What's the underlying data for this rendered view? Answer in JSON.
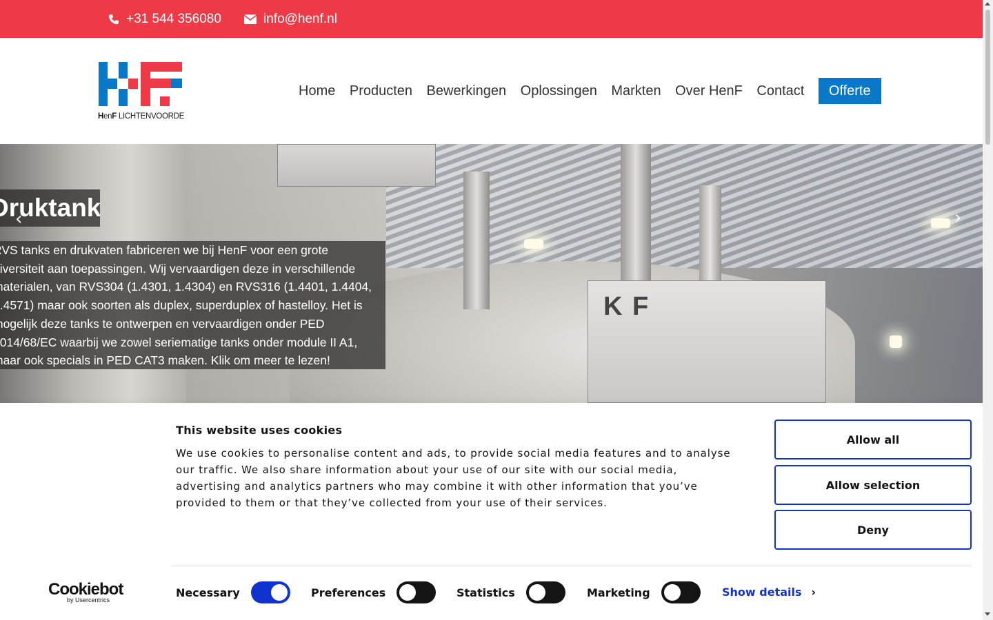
{
  "topbar": {
    "phone": "+31 544 356080",
    "email": "info@henf.nl",
    "bg_color": "#ee3a46"
  },
  "logo": {
    "text_bold1": "H",
    "text_en": "en",
    "text_bold2": "F",
    "text_rest": " LICHTENVOORDE"
  },
  "nav": {
    "items": [
      "Home",
      "Producten",
      "Bewerkingen",
      "Oplossingen",
      "Markten",
      "Over HenF",
      "Contact"
    ],
    "cta": "Offerte",
    "cta_color": "#0a78c8"
  },
  "hero": {
    "title": "Druktanks",
    "text": "RVS tanks en drukvaten fabriceren we bij HenF voor een grote diversiteit aan toepassingen. Wij vervaardigen deze in verschillende materialen, van RVS304 (1.4301, 1.4304) en RVS316 (1.4401, 1.4404, 1.4571) maar ook soorten als duplex, superduplex of hastelloy. Het is mogelijk deze tanks te ontwerpen en vervaardigen onder PED 2014/68/EC waarbij we zowel seriematige tanks onder module II A1, maar ook specials in PED CAT3 maken. Klik om meer te lezen!",
    "prev_icon": "chevron-left-icon",
    "next_icon": "chevron-right-icon"
  },
  "cookie": {
    "title": "This website uses cookies",
    "description": "We use cookies to personalise content and ads, to provide social media features and to analyse our traffic. We also share information about your use of our site with our social media, advertising and analytics partners who may combine it with other information that you’ve provided to them or that they’ve collected from your use of their services.",
    "allow_all": "Allow all",
    "allow_selection": "Allow selection",
    "deny": "Deny",
    "brand": "Cookiebot",
    "brand_by": "by Usercentrics",
    "toggles": [
      {
        "label": "Necessary",
        "on": true
      },
      {
        "label": "Preferences",
        "on": false
      },
      {
        "label": "Statistics",
        "on": false
      },
      {
        "label": "Marketing",
        "on": false
      }
    ],
    "show_details": "Show details",
    "accent_color": "#1032cf"
  }
}
